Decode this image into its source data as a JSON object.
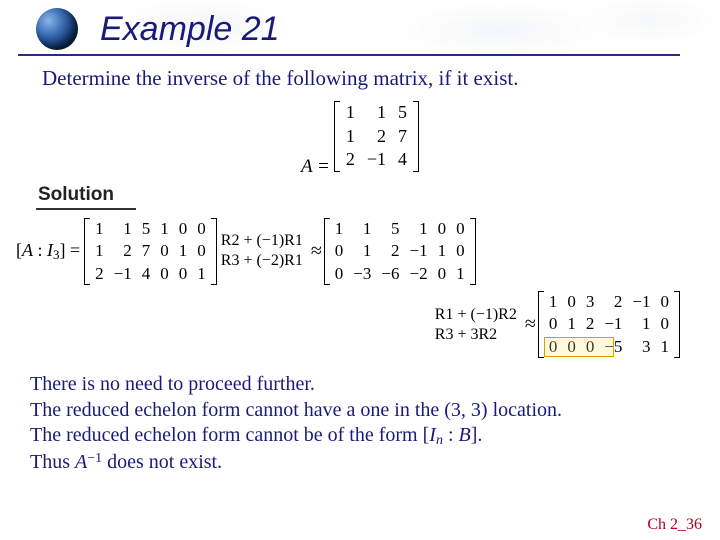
{
  "header": {
    "title": "Example 21"
  },
  "prompt": "Determine the inverse of the following matrix, if it exist.",
  "matrixA": {
    "label": "A =",
    "rows": [
      [
        "1",
        "1",
        "5"
      ],
      [
        "1",
        "2",
        "7"
      ],
      [
        "2",
        "−1",
        "4"
      ]
    ]
  },
  "solution_label": "Solution",
  "work": {
    "lhs_label": "[A : I₃] =",
    "augmented0": [
      [
        "1",
        "1",
        "5",
        "1",
        "0",
        "0"
      ],
      [
        "1",
        "2",
        "7",
        "0",
        "1",
        "0"
      ],
      [
        "2",
        "−1",
        "4",
        "0",
        "0",
        "1"
      ]
    ],
    "ops1": [
      "",
      "R2 + (−1)R1",
      "R3 + (−2)R1"
    ],
    "approx": "≈",
    "augmented1": [
      [
        "1",
        "1",
        "5",
        "1",
        "0",
        "0"
      ],
      [
        "0",
        "1",
        "2",
        "−1",
        "1",
        "0"
      ],
      [
        "0",
        "−3",
        "−6",
        "−2",
        "0",
        "1"
      ]
    ],
    "ops2": [
      "R1 + (−1)R2",
      "",
      "R3 + 3R2"
    ],
    "augmented2": [
      [
        "1",
        "0",
        "3",
        "2",
        "−1",
        "0"
      ],
      [
        "0",
        "1",
        "2",
        "−1",
        "1",
        "0"
      ],
      [
        "0",
        "0",
        "0",
        "−5",
        "3",
        "1"
      ]
    ]
  },
  "conclusion": {
    "l1": "There is no need to proceed further.",
    "l2": "The reduced echelon form cannot have a one in the (3, 3) location.",
    "l3_a": "The reduced echelon form cannot be of the form [",
    "l3_b": "I",
    "l3_sub": "n",
    "l3_c": " : ",
    "l3_d": "B",
    "l3_e": "].",
    "l4_a": "Thus ",
    "l4_b": "A",
    "l4_sup": "−1",
    "l4_c": " does not exist."
  },
  "footer": "Ch 2_36"
}
